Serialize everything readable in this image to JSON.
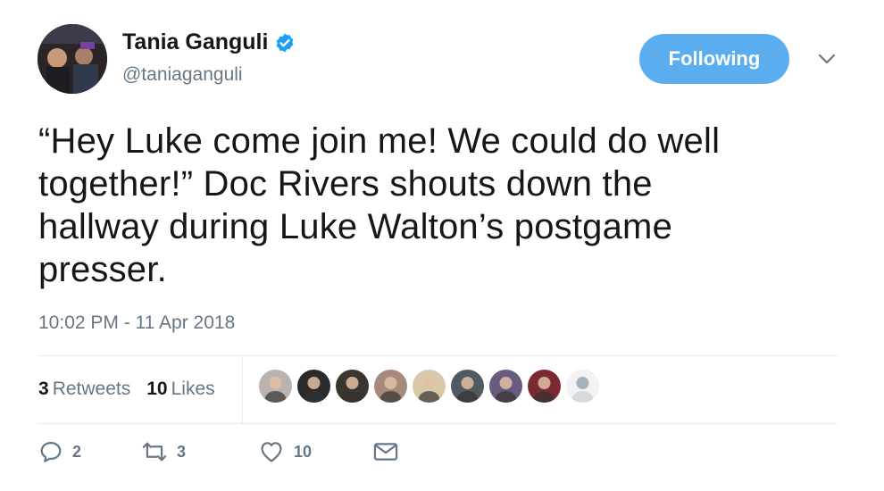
{
  "author": {
    "name": "Tania Ganguli",
    "handle": "@taniaganguli",
    "verified": true
  },
  "follow_button": {
    "label": "Following",
    "color": "#5aaef0"
  },
  "menu": {
    "icon": "chevron-down-icon"
  },
  "tweet": {
    "lines": [
      "“Hey Luke come join me! We could do well",
      "together!” Doc Rivers shouts down the",
      "hallway during Luke Walton’s postgame",
      "presser."
    ],
    "timestamp": "10:02 PM - 11 Apr 2018"
  },
  "stats": {
    "retweets_count": "3",
    "retweets_label": "Retweets",
    "likes_count": "10",
    "likes_label": "Likes"
  },
  "likers": [
    {
      "icon": "avatar-icon",
      "color": "#b9b2ad"
    },
    {
      "icon": "avatar-icon",
      "color": "#2a2a2a"
    },
    {
      "icon": "avatar-icon",
      "color": "#3b3530"
    },
    {
      "icon": "avatar-icon",
      "color": "#a88a7a"
    },
    {
      "icon": "avatar-icon",
      "color": "#d8c9a8"
    },
    {
      "icon": "avatar-icon",
      "color": "#4f5a63"
    },
    {
      "icon": "avatar-icon",
      "color": "#6b5a80"
    },
    {
      "icon": "avatar-icon",
      "color": "#7a2a30"
    },
    {
      "icon": "avatar-icon",
      "color": "#f2f2f2"
    }
  ],
  "actions": {
    "reply_count": "2",
    "retweet_count": "3",
    "like_count": "10"
  },
  "colors": {
    "accent": "#1da1f2",
    "muted": "#657786",
    "divider": "#e6ecf0"
  }
}
